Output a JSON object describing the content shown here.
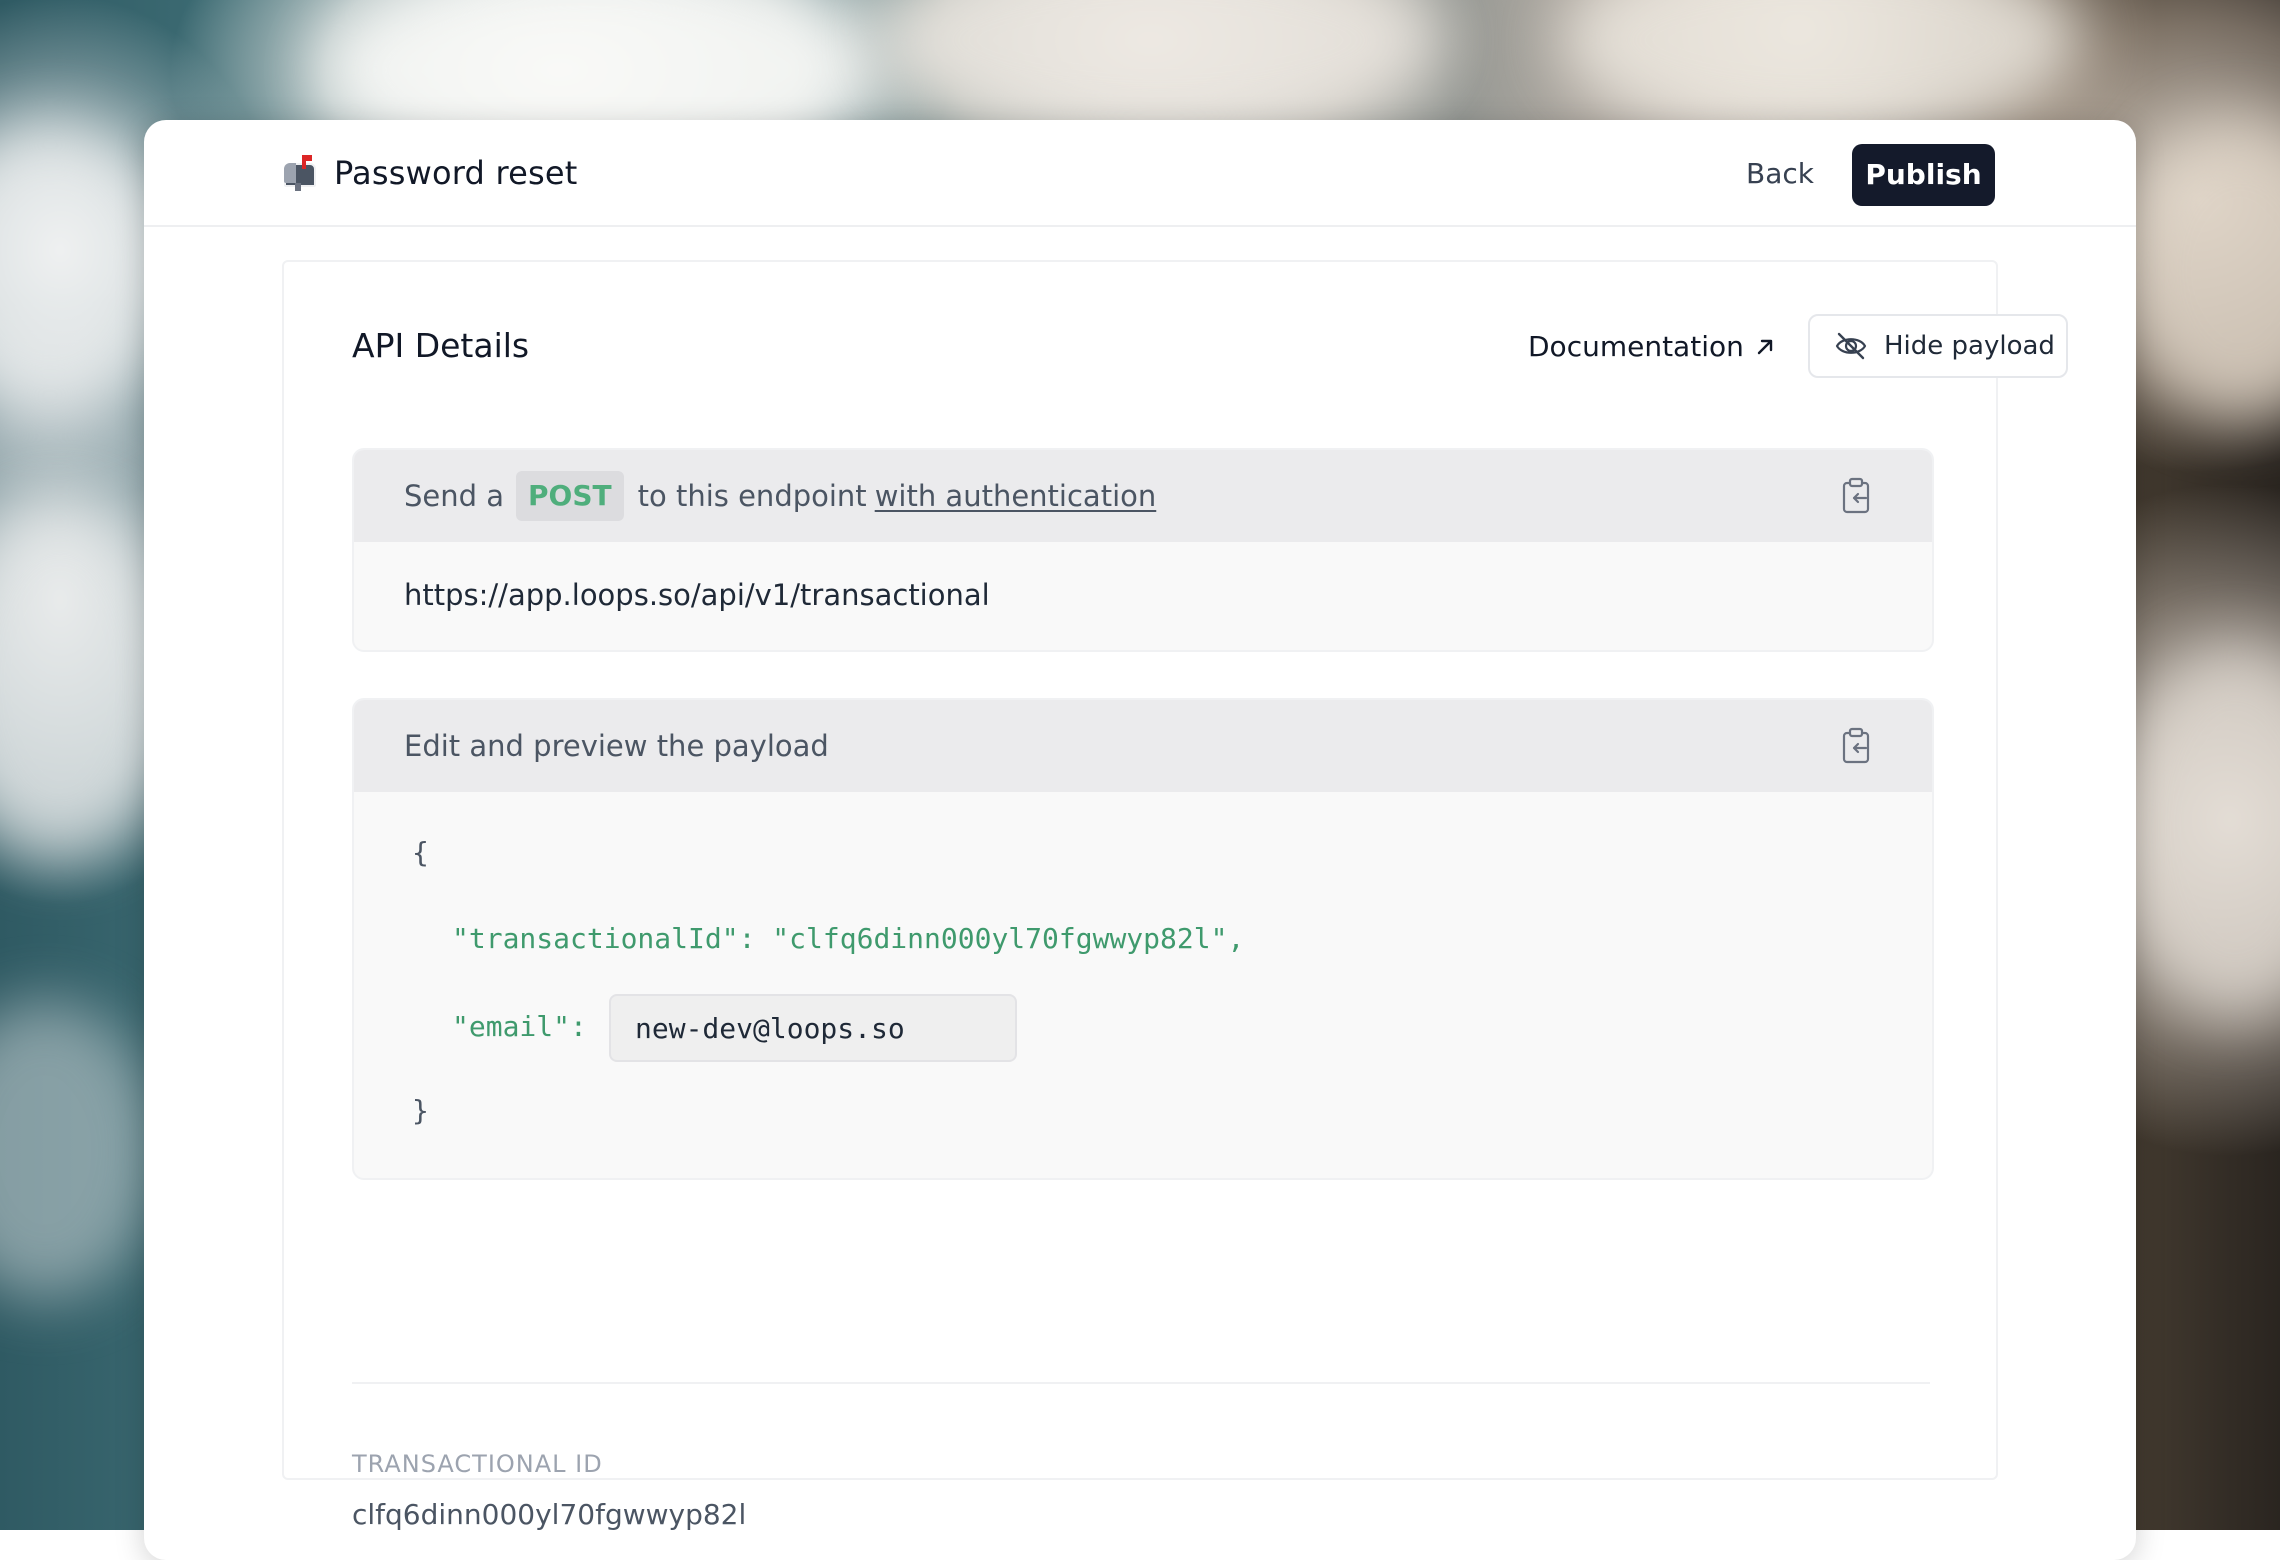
{
  "header": {
    "title": "Password reset",
    "title_icon": "mailbox-icon",
    "back_label": "Back",
    "publish_label": "Publish"
  },
  "panel": {
    "title": "API Details",
    "documentation_label": "Documentation",
    "hide_payload_label": "Hide payload"
  },
  "endpoint": {
    "prefix": "Send a",
    "method": "POST",
    "middle": "to this endpoint",
    "auth_link": "with authentication",
    "url": "https://app.loops.so/api/v1/transactional"
  },
  "payload": {
    "header_label": "Edit and preview the payload",
    "open_brace": "{",
    "close_brace": "}",
    "transactional_key": "\"transactionalId\":",
    "transactional_value": "\"clfq6dinn000yl70fgwwyp82l\",",
    "email_key": "\"email\":",
    "email_value": "new-dev@loops.so"
  },
  "details": {
    "transactional_id_label": "TRANSACTIONAL ID",
    "transactional_id_value": "clfq6dinn000yl70fgwwyp82l"
  },
  "colors": {
    "publish_bg": "#141a2b",
    "post_green": "#4fae7c",
    "code_green": "#3f9a6d"
  }
}
